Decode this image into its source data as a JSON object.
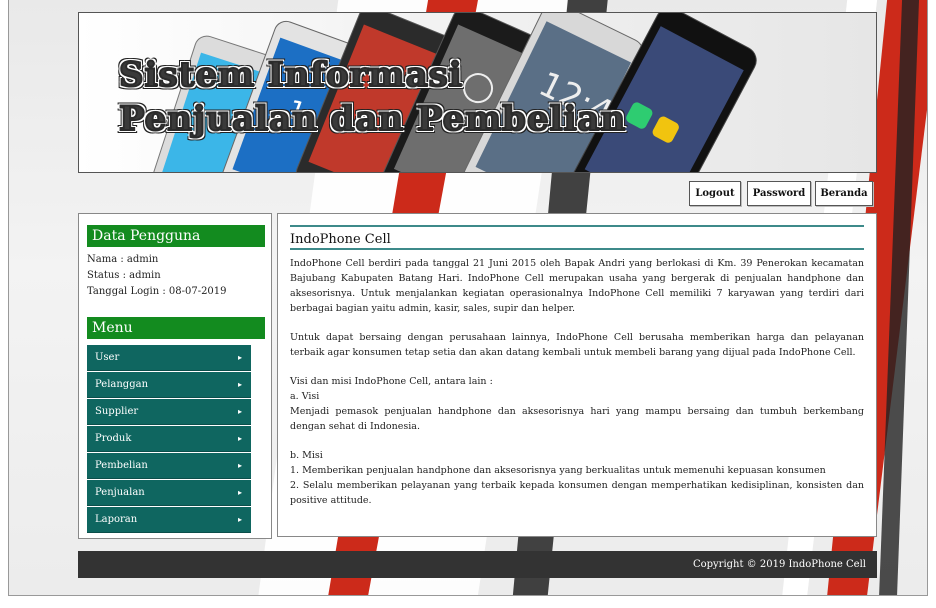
{
  "header": {
    "title_line1": "Sistem Informasi",
    "title_line2": "Penjualan dan Pembelian"
  },
  "topnav": {
    "logout": "Logout",
    "password": "Password",
    "beranda": "Beranda"
  },
  "sidebar": {
    "user_heading": "Data Pengguna",
    "nama": "Nama : admin",
    "status": "Status : admin",
    "tanggal_login": "Tanggal Login : 08-07-2019",
    "menu_heading": "Menu",
    "menu_items": [
      {
        "label": "User"
      },
      {
        "label": "Pelanggan"
      },
      {
        "label": "Supplier"
      },
      {
        "label": "Produk"
      },
      {
        "label": "Pembelian"
      },
      {
        "label": "Penjualan"
      },
      {
        "label": "Laporan"
      }
    ]
  },
  "main": {
    "title": "IndoPhone Cell",
    "paragraph1": "IndoPhone Cell berdiri pada tanggal 21 Juni 2015 oleh Bapak Andri yang berlokasi di Km. 39 Penerokan kecamatan Bajubang Kabupaten Batang Hari. IndoPhone Cell merupakan usaha yang bergerak di penjualan handphone dan aksesorisnya. Untuk menjalankan kegiatan operasionalnya IndoPhone Cell memiliki 7 karyawan yang terdiri dari berbagai bagian yaitu admin, kasir, sales, supir dan helper.",
    "paragraph2": "Untuk dapat bersaing dengan perusahaan lainnya, IndoPhone Cell berusaha memberikan harga dan pelayanan terbaik agar konsumen tetap setia dan akan datang kembali untuk membeli barang yang dijual pada IndoPhone Cell.",
    "visi_misi_intro": "Visi dan misi IndoPhone Cell, antara lain :",
    "visi_label": "a. Visi",
    "visi_text": "Menjadi pemasok penjualan handphone dan aksesorisnya hari yang mampu bersaing dan tumbuh berkembang dengan sehat di Indonesia.",
    "misi_label": "b. Misi",
    "misi_1": "1. Memberikan penjualan handphone dan aksesorisnya yang berkualitas untuk memenuhi kepuasan konsumen",
    "misi_2": "2. Selalu memberikan pelayanan yang terbaik kepada konsumen dengan memperhatikan kedisiplinan, konsisten dan positive attitude."
  },
  "footer": {
    "copyright": "Copyright © 2019 IndoPhone Cell"
  },
  "icons": {
    "menu_arrow": "chevron-right-icon"
  },
  "colors": {
    "sidebar_heading": "#138b1f",
    "menu_item": "#0f6660",
    "footer": "#333333",
    "accent_stripe": "#cc2a1a"
  }
}
